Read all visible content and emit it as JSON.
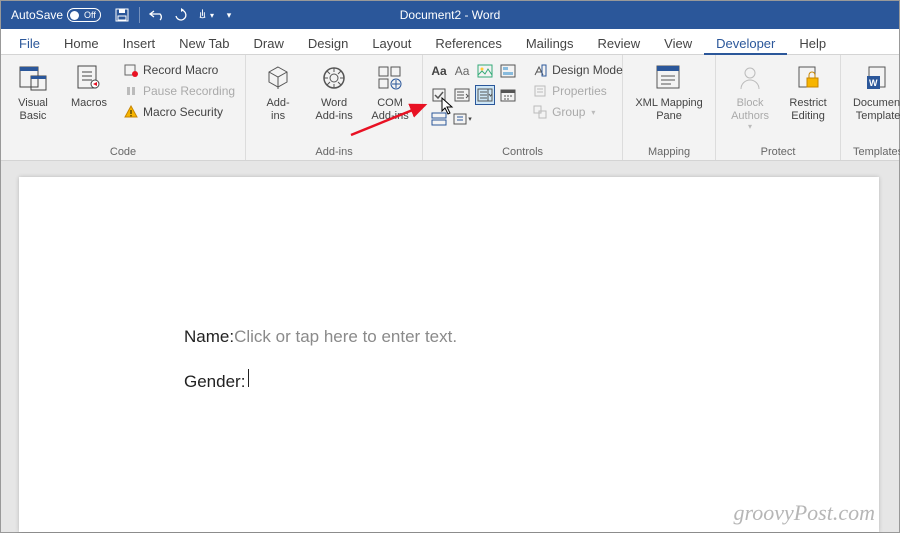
{
  "titlebar": {
    "autosave_label": "AutoSave",
    "autosave_state": "Off",
    "doc_title": "Document2  -  Word"
  },
  "tabs": {
    "file": "File",
    "home": "Home",
    "insert": "Insert",
    "newtab": "New Tab",
    "draw": "Draw",
    "design": "Design",
    "layout": "Layout",
    "references": "References",
    "mailings": "Mailings",
    "review": "Review",
    "view": "View",
    "developer": "Developer",
    "help": "Help"
  },
  "ribbon": {
    "code": {
      "label": "Code",
      "visual_basic": "Visual\nBasic",
      "macros": "Macros",
      "record": "Record Macro",
      "pause": "Pause Recording",
      "security": "Macro Security"
    },
    "addins": {
      "label": "Add-ins",
      "addins": "Add-\nins",
      "word": "Word\nAdd-ins",
      "com": "COM\nAdd-ins"
    },
    "controls": {
      "label": "Controls",
      "design": "Design Mode",
      "properties": "Properties",
      "group": "Group"
    },
    "mapping": {
      "label": "Mapping",
      "xml": "XML Mapping\nPane"
    },
    "protect": {
      "label": "Protect",
      "block": "Block\nAuthors",
      "restrict": "Restrict\nEditing"
    },
    "templates": {
      "label": "Templates",
      "doc": "Document\nTemplate"
    }
  },
  "document": {
    "name_label": "Name: ",
    "name_placeholder": "Click or tap here to enter text.",
    "gender_label": "Gender: "
  },
  "watermark": "groovyPost.com"
}
